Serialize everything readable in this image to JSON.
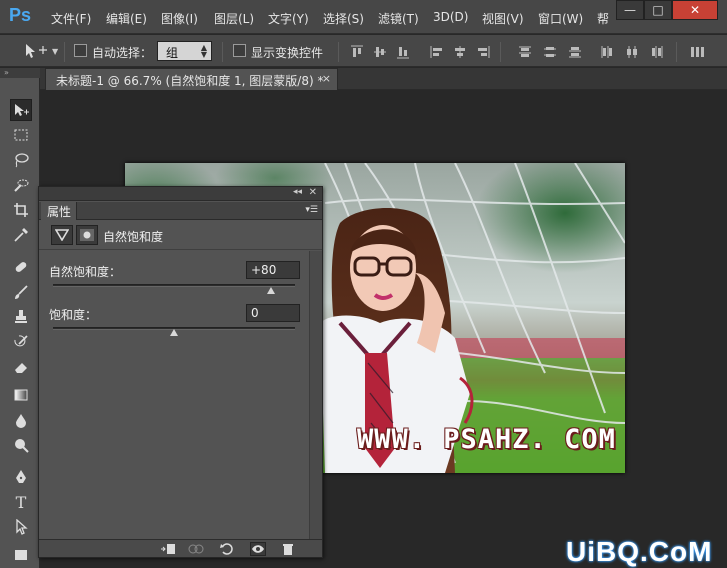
{
  "app": {
    "logo": "Ps"
  },
  "menu": [
    "文件(F)",
    "编辑(E)",
    "图像(I)",
    "图层(L)",
    "文字(Y)",
    "选择(S)",
    "滤镜(T)",
    "3D(D)",
    "视图(V)",
    "窗口(W)",
    "帮"
  ],
  "window_controls": {
    "minimize": "—",
    "maximize": "□",
    "close": "✕"
  },
  "options": {
    "auto_select_label": "自动选择：",
    "auto_select_value": "组",
    "show_transform_label": "显示变换控件"
  },
  "document_tab": {
    "title": "未标题-1 @ 66.7% (自然饱和度 1, 图层蒙版/8) *",
    "close": "×"
  },
  "panel": {
    "collapse_glyph": "◂◂",
    "close_glyph": "✕",
    "tab_label": "属性",
    "adjustment_title": "自然饱和度",
    "vibrance": {
      "label": "自然饱和度：",
      "value": "+80",
      "slider_fraction": 0.9
    },
    "saturation": {
      "label": "饱和度：",
      "value": "0",
      "slider_fraction": 0.5
    }
  },
  "canvas": {
    "watermark": "WWW. PSAHZ. COM"
  },
  "site_logo": "UiBQ.CoM",
  "colors": {
    "ps_blue": "#4aa8f0",
    "ui_dark": "#535353",
    "canvas_bg": "#282828"
  }
}
